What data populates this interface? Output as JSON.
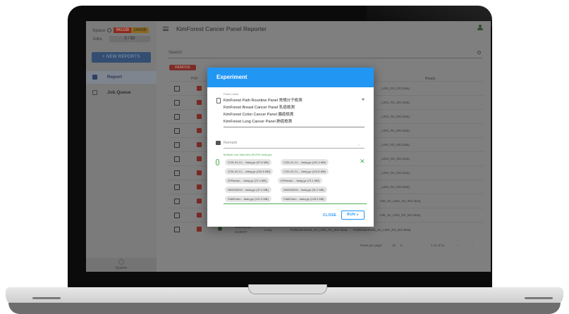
{
  "sidebar": {
    "space_label": "Space",
    "space_used": "941GB",
    "space_total": "244GB",
    "jobs_label": "Jobs",
    "jobs_value": "0 / 50",
    "new_reports_label": "+ NEW REPORTS",
    "nav": [
      {
        "label": "Report",
        "icon": "report-icon"
      },
      {
        "label": "Job Queue",
        "icon": "queue-icon"
      }
    ],
    "system_label": "System"
  },
  "header": {
    "title": "KimForest Cancer Panel Reporter"
  },
  "search": {
    "placeholder": "Search"
  },
  "table": {
    "remove_label": "REMOVE",
    "headers": [
      "PDF",
      "Reads"
    ],
    "rows": [
      "_L001_R2_001.fastq",
      "_L001_R2_001.fastq",
      "_L001_R2_001.fastq",
      "_L001_R2_001.fastq",
      "_L001_R2_001.fastq",
      "_L001_R2_001.fastq",
      "_L001_R2_001.fastq",
      "_L001_R2_001.fastq",
      "ed5_S2_L001_R2_001.fastq",
      "ed5_S2_L001_R2_001.fastq"
    ],
    "last_row": {
      "date": "2020-03-20",
      "time": "10:20:07",
      "type": "Lung",
      "r1": "PathExtension5_S2_L001_R1_001.fastq",
      "r2": "PathExtension5_S2_L001_R2_001.fastq"
    }
  },
  "pager": {
    "rows_label": "Rows per page:",
    "rows_value": "10",
    "range": "1-11 of 11",
    "prev": "‹",
    "next": "›"
  },
  "dialog": {
    "title": "Experiment",
    "panel_label": "Panel name",
    "panel_options": [
      "KimForest Path Rountine Panel 常規分子檢測",
      "KimForest Breast Cancer Panel 乳癌檢測",
      "KimForest Colon Cancer Panel 腸癌檢測",
      "KimForest Lung Cancer Panel 肺癌檢測"
    ],
    "remark_placeholder": "Remark",
    "files_label": "Multiple raw data files (R1/R2 fastq.gz)",
    "files": [
      [
        "COK-01-CL... fastq.gz (97.8 MB)",
        "COK-01-CL... fastq.gz (102.4 MB)"
      ],
      [
        "COK-02-CL... fastq.gz (106.5 MB)",
        "COK-02-CL... fastq.gz (110.8 MB)"
      ],
      [
        "KFBreast-... fastq.gz (72.4 MB)",
        "KFBreast-... fastq.gz (73.1 MB)"
      ],
      [
        "N00000000... fastq.gz (47.4 MB)",
        "N00000000... fastq.gz (51.2 MB)"
      ],
      [
        "PathExten... fastq.gz (121.3 MB)",
        "PathExten... fastq.gz (125.9 MB)"
      ]
    ],
    "close_label": "CLOSE",
    "run_label": "RUN ▸"
  },
  "colors": {
    "primary": "#2196f3",
    "success": "#4caf50",
    "danger": "#f44336",
    "new_button": "#3f51b5"
  }
}
